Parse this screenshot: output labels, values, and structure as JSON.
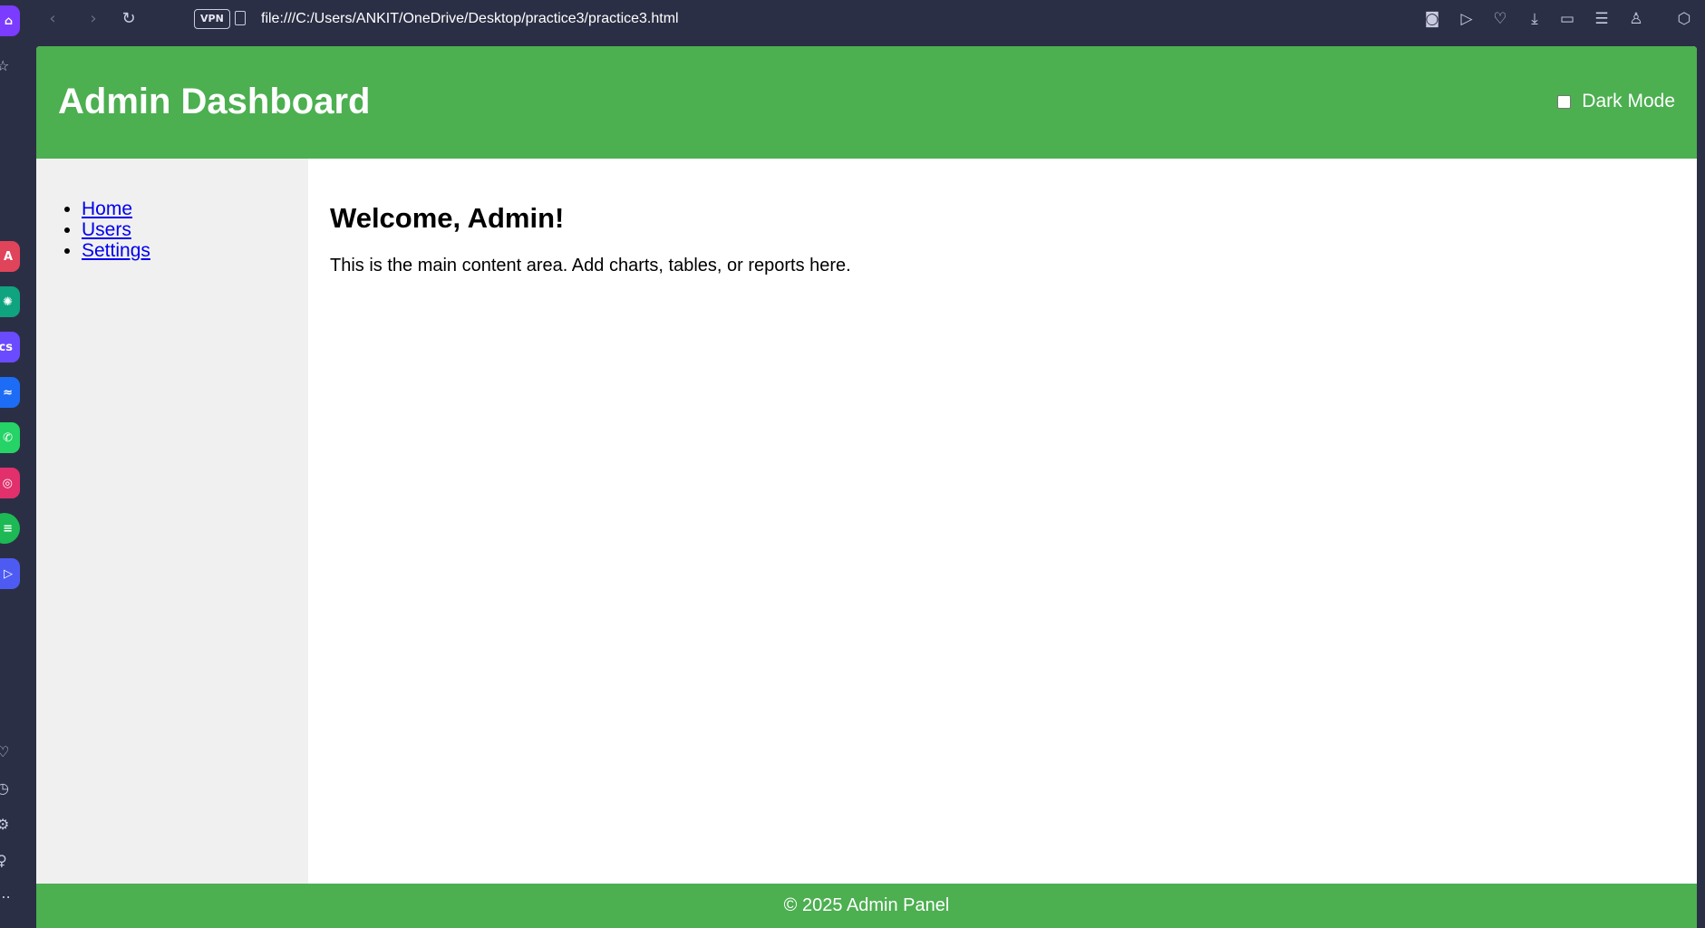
{
  "browser": {
    "address": "file:///C:/Users/ANKIT/OneDrive/Desktop/practice3/practice3.html",
    "vpn_label": "VPN",
    "nav": {
      "back_icon": "chevron-left-icon",
      "forward_icon": "chevron-right-icon",
      "reload_icon": "reload-icon"
    },
    "toolbar_icons": [
      "camera-icon",
      "play-icon",
      "heart-icon",
      "download-icon",
      "battery-icon",
      "menu-icon",
      "account-icon",
      "box-icon"
    ],
    "sidebar_apps": [
      "home-icon",
      "star-icon",
      "aria-icon",
      "chatgpt-icon",
      "ai-app-icon",
      "messenger-icon",
      "whatsapp-icon",
      "instagram-icon",
      "spotify-icon",
      "player-icon",
      "heart-icon",
      "history-icon",
      "settings-icon",
      "lightbulb-icon",
      "more-icon"
    ],
    "accent": "#4caf50",
    "chrome_color": "#2b2f45"
  },
  "header": {
    "title": "Admin Dashboard",
    "dark_mode_label": "Dark Mode",
    "dark_mode_checked": false
  },
  "sidebar": {
    "links": [
      {
        "label": "Home"
      },
      {
        "label": "Users"
      },
      {
        "label": "Settings"
      }
    ]
  },
  "main": {
    "heading": "Welcome, Admin!",
    "body": "This is the main content area. Add charts, tables, or reports here."
  },
  "footer": {
    "text": "© 2025 Admin Panel"
  }
}
